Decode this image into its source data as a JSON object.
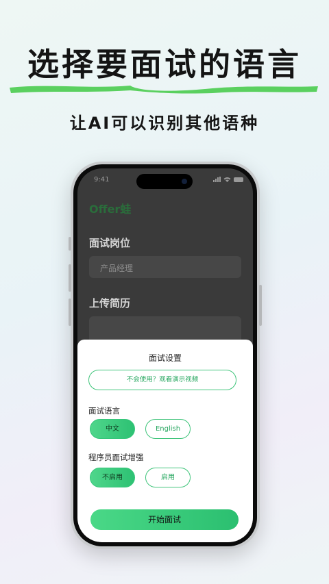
{
  "headline": "选择要面试的语言",
  "subheadline": "让AI可以识别其他语种",
  "phone": {
    "status_time": "9:41",
    "app_logo": "Offer蛙",
    "position_label": "面试岗位",
    "position_value": "产品经理",
    "resume_label": "上传简历"
  },
  "sheet": {
    "title": "面试设置",
    "demo_button": "不会使用？观看演示视频",
    "language_label": "面试语言",
    "language_options": [
      {
        "label": "中文",
        "selected": true
      },
      {
        "label": "English",
        "selected": false
      }
    ],
    "programmer_label": "程序员面试增强",
    "programmer_options": [
      {
        "label": "不启用",
        "selected": true
      },
      {
        "label": "启用",
        "selected": false
      }
    ],
    "start_button": "开始面试"
  },
  "colors": {
    "accent": "#2dc173",
    "brush": "#5ad05f",
    "logo": "#2a6d3b"
  }
}
